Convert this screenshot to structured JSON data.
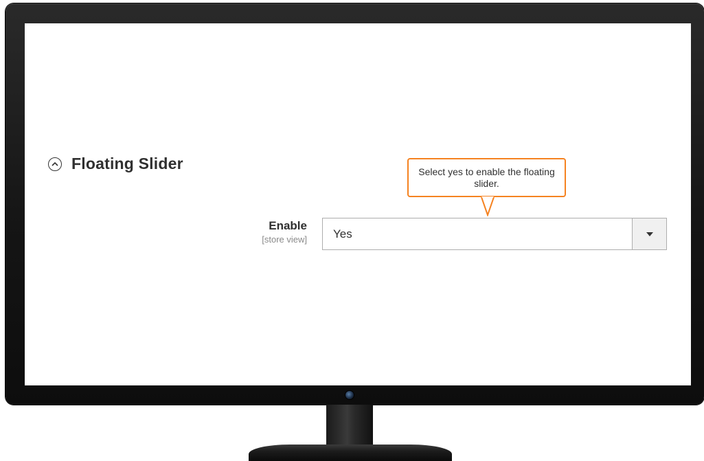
{
  "section": {
    "title": "Floating Slider",
    "icon": "collapse-circle-icon"
  },
  "field": {
    "label": "Enable",
    "scope": "[store view]",
    "value": "Yes",
    "dropdown_icon": "caret-down-icon"
  },
  "callout": {
    "text": "Select yes to enable the floating slider.",
    "border_color": "#f58220"
  },
  "colors": {
    "accent": "#f58220",
    "text": "#303030",
    "bezel": "#151515"
  }
}
